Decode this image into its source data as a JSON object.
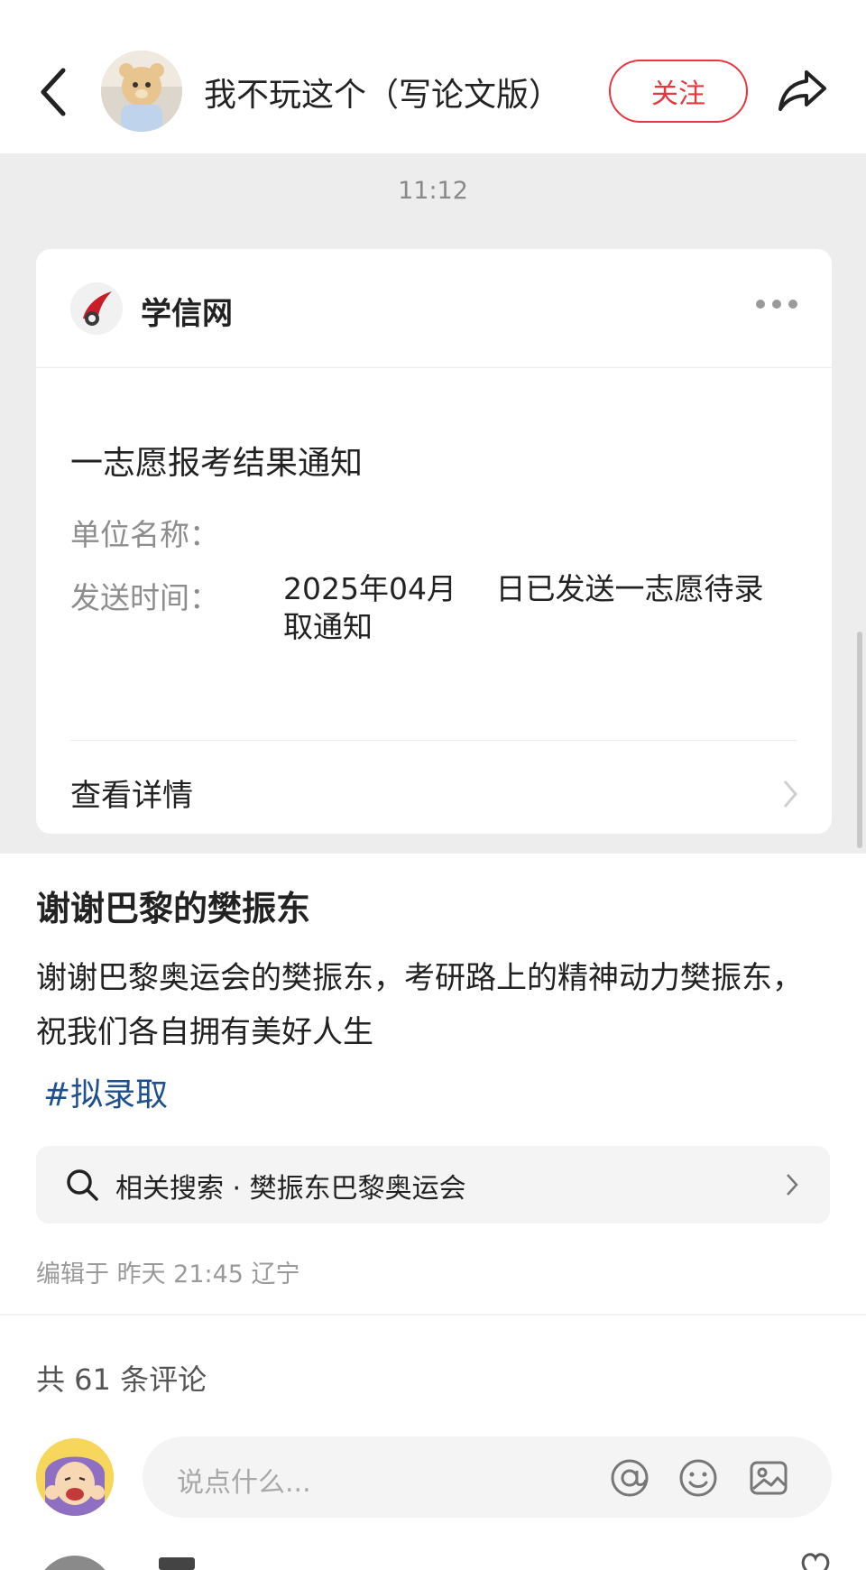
{
  "header": {
    "back_icon": "chevron-left-icon",
    "title": "我不玩这个（写论文版）",
    "follow_label": "关注",
    "share_icon": "share-arrow-icon",
    "accent": "#e8363f"
  },
  "screenshot": {
    "time": "11:12",
    "source_name": "学信网",
    "more_icon": "more-dots-icon",
    "notice_title": "一志愿报考结果通知",
    "unit_label": "单位名称：",
    "unit_value": "",
    "send_label": "发送时间：",
    "send_value": "2025年04月　 日已发送一志愿待录取通知",
    "view_detail": "查看详情"
  },
  "post": {
    "title": "谢谢巴黎的樊振东",
    "body": "谢谢巴黎奥运会的樊振东，考研路上的精神动力樊振东，祝我们各自拥有美好人生",
    "hashtag": "#拟录取",
    "hashtag_color": "#1f4f8f",
    "related_search": "相关搜索 · 樊振东巴黎奥运会",
    "edit_info": "编辑于 昨天 21:45 辽宁",
    "comment_count": "共 61 条评论"
  },
  "comment_box": {
    "placeholder": "说点什么...",
    "icons": [
      "at-icon",
      "emoji-icon",
      "image-icon"
    ]
  }
}
